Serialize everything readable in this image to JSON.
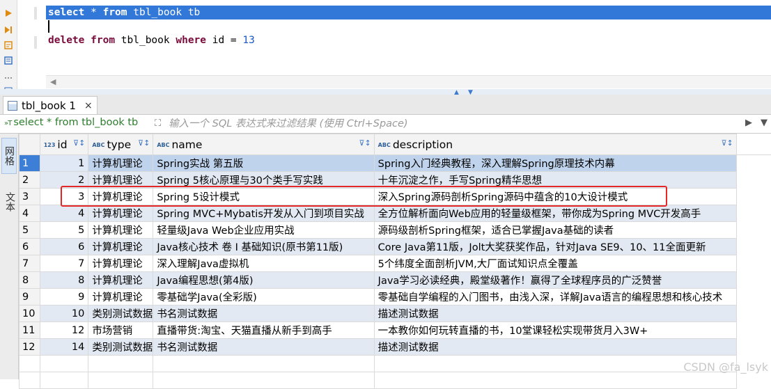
{
  "editor": {
    "lines": [
      {
        "parts": [
          {
            "t": "select",
            "k": "kw"
          },
          {
            "t": " * "
          },
          {
            "t": "from",
            "k": "kw"
          },
          {
            "t": " tbl_book tb"
          }
        ],
        "selected": true
      },
      {
        "parts": [],
        "cursor": true
      },
      {
        "parts": [
          {
            "t": "delete",
            "k": "kw"
          },
          {
            "t": " "
          },
          {
            "t": "from",
            "k": "kw"
          },
          {
            "t": " tbl_book "
          },
          {
            "t": "where",
            "k": "kw"
          },
          {
            "t": " id = "
          },
          {
            "t": "13",
            "k": "num"
          }
        ]
      }
    ]
  },
  "result_tab": {
    "label": "tbl_book 1",
    "close": "×"
  },
  "filter_bar": {
    "sql_prefix": "»T",
    "sql": "select * from tbl_book tb",
    "filter_placeholder": "输入一个 SQL 表达式来过滤结果 (使用 Ctrl+Space)"
  },
  "side_panel": {
    "grid_label": "网格",
    "text_label": "文本"
  },
  "grid": {
    "columns": [
      {
        "label": "id",
        "type_badge": "123"
      },
      {
        "label": "type",
        "type_badge": "ABC"
      },
      {
        "label": "name",
        "type_badge": "ABC"
      },
      {
        "label": "description",
        "type_badge": "ABC"
      }
    ],
    "rows": [
      {
        "n": "1",
        "id": "1",
        "type": "计算机理论",
        "name": "Spring实战 第五版",
        "description": "Spring入门经典教程，深入理解Spring原理技术内幕"
      },
      {
        "n": "2",
        "id": "2",
        "type": "计算机理论",
        "name": "Spring 5核心原理与30个类手写实践",
        "description": "十年沉淀之作，手写Spring精华思想"
      },
      {
        "n": "3",
        "id": "3",
        "type": "计算机理论",
        "name": "Spring 5设计模式",
        "description": "深入Spring源码剖析Spring源码中蕴含的10大设计模式"
      },
      {
        "n": "4",
        "id": "4",
        "type": "计算机理论",
        "name": "Spring MVC+Mybatis开发从入门到项目实战",
        "description": "全方位解析面向Web应用的轻量级框架，带你成为Spring MVC开发高手"
      },
      {
        "n": "5",
        "id": "5",
        "type": "计算机理论",
        "name": "轻量级Java Web企业应用实战",
        "description": "源码级剖析Spring框架，适合已掌握Java基础的读者"
      },
      {
        "n": "6",
        "id": "6",
        "type": "计算机理论",
        "name": "Java核心技术 卷 I  基础知识(原书第11版)",
        "description": "Core Java第11版，Jolt大奖获奖作品，针对Java SE9、10、11全面更新"
      },
      {
        "n": "7",
        "id": "7",
        "type": "计算机理论",
        "name": "深入理解Java虚拟机",
        "description": "5个纬度全面剖析JVM,大厂面试知识点全覆盖"
      },
      {
        "n": "8",
        "id": "8",
        "type": "计算机理论",
        "name": "Java编程思想(第4版)",
        "description": "Java学习必读经典，殿堂级著作！赢得了全球程序员的广泛赞誉"
      },
      {
        "n": "9",
        "id": "9",
        "type": "计算机理论",
        "name": "零基础学Java(全彩版)",
        "description": "零基础自学编程的入门图书，由浅入深，详解Java语言的编程思想和核心技术"
      },
      {
        "n": "10",
        "id": "10",
        "type": "类别测试数据",
        "name": "书名测试数据",
        "description": "描述测试数据"
      },
      {
        "n": "11",
        "id": "12",
        "type": "市场营销",
        "name": "直播带货:淘宝、天猫直播从新手到高手",
        "description": "一本教你如何玩转直播的书，10堂课轻松实现带货月入3W+"
      },
      {
        "n": "12",
        "id": "14",
        "type": "类别测试数据",
        "name": "书名测试数据",
        "description": "描述测试数据"
      }
    ],
    "selected_row": "1"
  },
  "watermark": "CSDN @fa_lsyk"
}
